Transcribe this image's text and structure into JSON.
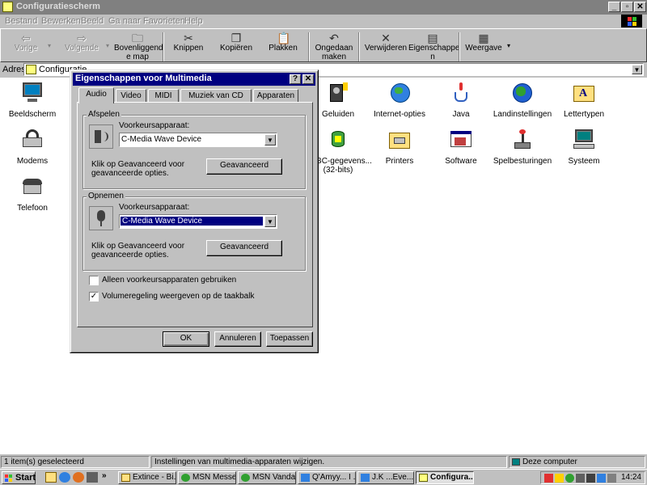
{
  "window": {
    "title": "Configuratiescherm"
  },
  "menu": [
    "Bestand",
    "Bewerken",
    "Beeld",
    "Ga naar",
    "Favorieten",
    "Help"
  ],
  "toolbar": {
    "back": "Vorige",
    "forward": "Volgende",
    "up_line1": "Bovenliggend",
    "up_line2": "e map",
    "cut": "Knippen",
    "copy": "Kopiëren",
    "paste": "Plakken",
    "undo_line1": "Ongedaan",
    "undo_line2": "maken",
    "delete": "Verwijderen",
    "props_line1": "Eigenschappe",
    "props_line2": "n",
    "views": "Weergave"
  },
  "address": {
    "label": "Adres",
    "value": "Configuratie"
  },
  "icons": [
    {
      "label": "Beeldscherm",
      "icon": "monitor-icon"
    },
    {
      "label": "Geluiden",
      "icon": "speaker-icon"
    },
    {
      "label": "Internet-opties",
      "icon": "globe-icon"
    },
    {
      "label": "Java",
      "icon": "java-icon"
    },
    {
      "label": "Landinstellingen",
      "icon": "earth-icon"
    },
    {
      "label": "Lettertypen",
      "icon": "fonts-folder-icon"
    },
    {
      "label": "Modems",
      "icon": "modem-icon"
    },
    {
      "label": "ODBC-gegevens...",
      "label2": "(32-bits)",
      "icon": "database-icon"
    },
    {
      "label": "Printers",
      "icon": "printer-folder-icon"
    },
    {
      "label": "Software",
      "icon": "software-icon"
    },
    {
      "label": "Spelbesturingen",
      "icon": "joystick-icon"
    },
    {
      "label": "Systeem",
      "icon": "computer-icon"
    },
    {
      "label": "Telefoon",
      "icon": "telephone-icon"
    }
  ],
  "dialog": {
    "title": "Eigenschappen voor Multimedia",
    "tabs": [
      "Audio",
      "Video",
      "MIDI",
      "Muziek van CD",
      "Apparaten"
    ],
    "playback": {
      "group_label": "Afspelen",
      "device_label": "Voorkeursapparaat:",
      "device_value": "C-Media Wave Device",
      "hint_line1": "Klik op Geavanceerd voor",
      "hint_line2": "geavanceerde opties.",
      "advanced": "Geavanceerd"
    },
    "recording": {
      "group_label": "Opnemen",
      "device_label": "Voorkeursapparaat:",
      "device_value": "C-Media Wave Device",
      "hint_line1": "Klik op Geavanceerd voor",
      "hint_line2": "geavanceerde opties.",
      "advanced": "Geavanceerd"
    },
    "only_preferred": {
      "label": "Alleen voorkeursapparaten gebruiken",
      "checked": false
    },
    "volume_taskbar": {
      "label": "Volumeregeling weergeven op de taakbalk",
      "checked": true
    },
    "ok": "OK",
    "cancel": "Annuleren",
    "apply": "Toepassen"
  },
  "status": {
    "selection": "1 item(s) geselecteerd",
    "description": "Instellingen van multimedia-apparaten wijzigen.",
    "zone": "Deze computer"
  },
  "taskbar": {
    "start": "Start",
    "buttons": [
      "Extince - Bi...",
      "MSN Messe...",
      "MSN Vanda...",
      "Q'Amyy... I ...",
      "J.K     ...Eve...",
      "Configura..."
    ],
    "clock": "14:24"
  },
  "colors": {
    "title_active": "#000080",
    "title_inactive": "#808080",
    "face": "#c0c0c0"
  }
}
